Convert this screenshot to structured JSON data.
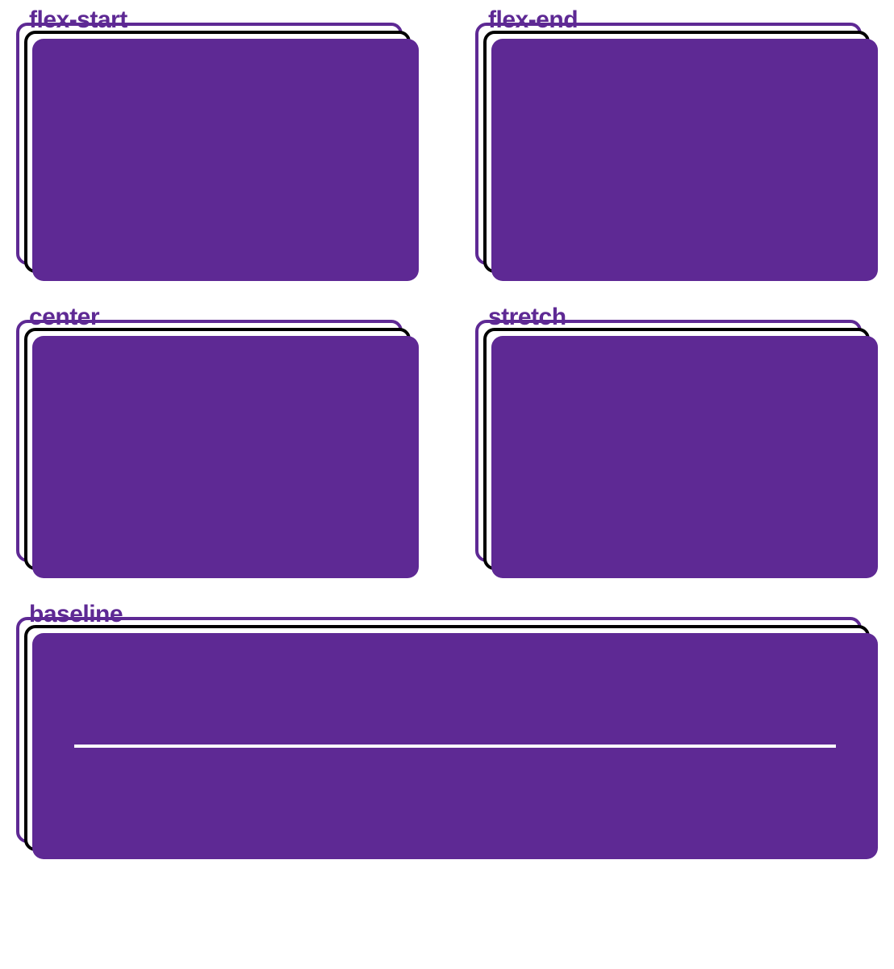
{
  "colors": {
    "purple": "#5e2994",
    "black": "#000000",
    "white": "#ffffff"
  },
  "items": [
    {
      "id": "flex-start",
      "label": "flex-start"
    },
    {
      "id": "flex-end",
      "label": "flex-end"
    },
    {
      "id": "center",
      "label": "center"
    },
    {
      "id": "stretch",
      "label": "stretch"
    },
    {
      "id": "baseline",
      "label": "baseline"
    }
  ]
}
